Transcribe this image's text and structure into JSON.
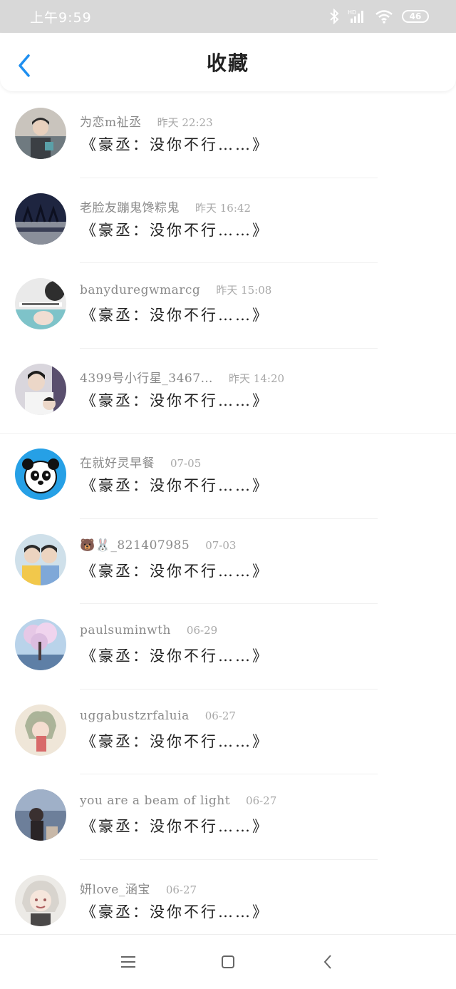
{
  "status_bar": {
    "time": "上午9:59",
    "battery": "46",
    "network": "HD"
  },
  "header": {
    "title": "收藏",
    "back_icon": "chevron-left-icon"
  },
  "colors": {
    "accent": "#1e8ff0",
    "status_bar": "#d8d8d8",
    "text": "#222222",
    "meta": "#8a8a8a"
  },
  "favorites": [
    {
      "user": "为恋m祉丞",
      "time": "昨天 22:23",
      "title": "《豪丞：没你不行……》"
    },
    {
      "user": "老脸友蹦鬼馋粽鬼",
      "time": "昨天 16:42",
      "title": "《豪丞：没你不行……》"
    },
    {
      "user": "banyduregwmarcg",
      "time": "昨天 15:08",
      "title": "《豪丞：没你不行……》"
    },
    {
      "user": "4399号小行星_3467…",
      "time": "昨天 14:20",
      "title": "《豪丞：没你不行……》"
    },
    {
      "user": "在就好灵早餐",
      "time": "07-05",
      "title": "《豪丞：没你不行……》"
    },
    {
      "user": "🐻🐰_821407985",
      "time": "07-03",
      "title": "《豪丞：没你不行……》"
    },
    {
      "user": "paulsuminwth",
      "time": "06-29",
      "title": "《豪丞：没你不行……》"
    },
    {
      "user": "uggabustzrfaluia",
      "time": "06-27",
      "title": "《豪丞：没你不行……》"
    },
    {
      "user": "you are a beam of light",
      "time": "06-27",
      "title": "《豪丞：没你不行……》"
    },
    {
      "user": "妍love_涵宝",
      "time": "06-27",
      "title": "《豪丞：没你不行……》"
    }
  ],
  "system_nav": {
    "menu_icon": "menu-icon",
    "home_icon": "home-square-icon",
    "back_icon": "back-triangle-icon"
  }
}
